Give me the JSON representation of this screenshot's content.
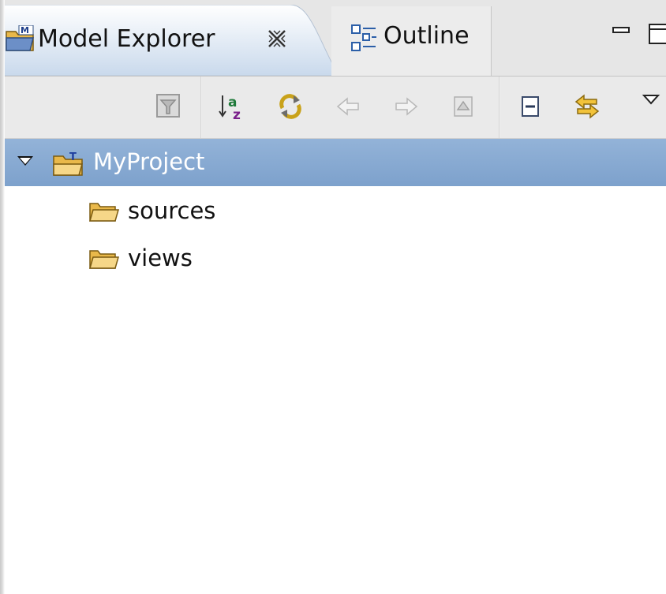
{
  "tabs": [
    {
      "label": "Model Explorer",
      "icon": "model-explorer-icon",
      "active": true,
      "closable": true
    },
    {
      "label": "Outline",
      "icon": "outline-icon",
      "active": false
    }
  ],
  "view_controls": {
    "minimize_icon": "minimize-icon",
    "maximize_icon": "maximize-icon"
  },
  "toolbar": {
    "buttons": [
      {
        "icon": "filter-icon",
        "enabled": false
      },
      {
        "icon": "sort-alphabetical-icon",
        "enabled": true
      },
      {
        "icon": "sync-icon",
        "enabled": true
      },
      {
        "icon": "back-arrow-icon",
        "enabled": false
      },
      {
        "icon": "forward-arrow-icon",
        "enabled": false
      },
      {
        "icon": "go-up-icon",
        "enabled": false
      },
      {
        "icon": "collapse-all-icon",
        "enabled": true
      },
      {
        "icon": "link-with-editor-icon",
        "enabled": true
      },
      {
        "icon": "view-menu-icon",
        "enabled": true
      }
    ]
  },
  "tree": {
    "root": {
      "label": "MyProject",
      "icon": "project-icon",
      "expanded": true,
      "selected": true
    },
    "children": [
      {
        "label": "sources",
        "icon": "folder-icon"
      },
      {
        "label": "views",
        "icon": "folder-icon"
      }
    ]
  },
  "colors": {
    "selection": "#7da1cc",
    "tab_active": "#cfdcec",
    "folder": "#e9b84a"
  }
}
